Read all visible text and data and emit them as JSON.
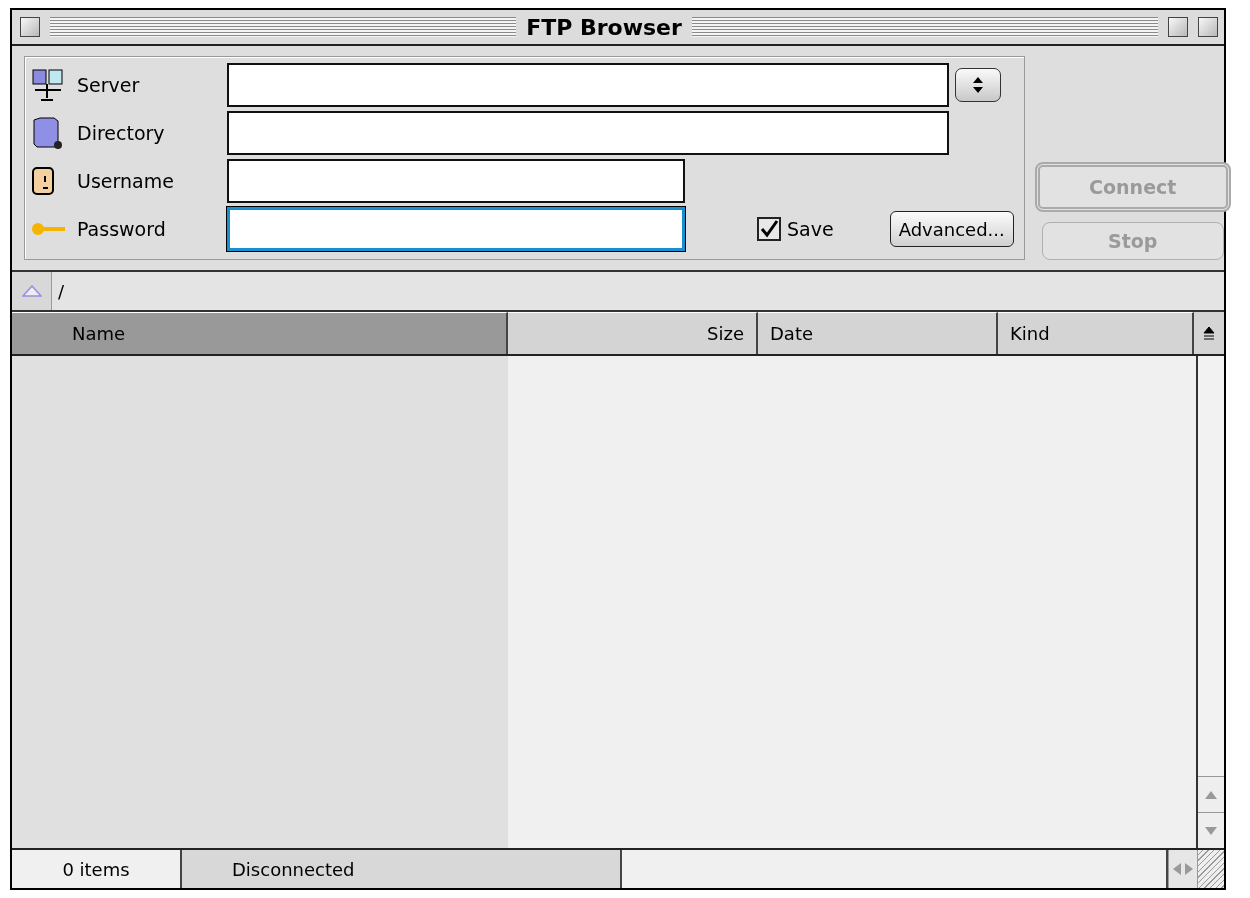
{
  "window": {
    "title": "FTP Browser"
  },
  "form": {
    "fields": [
      {
        "kind": "server",
        "label": "Server",
        "focused": false,
        "dropdown": true
      },
      {
        "kind": "directory",
        "label": "Directory",
        "focused": false,
        "dropdown": false
      },
      {
        "kind": "user",
        "label": "Username",
        "focused": false,
        "dropdown": false
      },
      {
        "kind": "key",
        "label": "Password",
        "focused": true,
        "dropdown": false
      }
    ],
    "save": {
      "label": "Save",
      "checked": true
    },
    "advanced_button": {
      "label": "Advanced...",
      "disabled": false
    },
    "buttons": [
      {
        "label": "Connect",
        "disabled": true,
        "default": true
      },
      {
        "label": "Stop",
        "disabled": true,
        "default": false
      }
    ]
  },
  "path": {
    "text": "/"
  },
  "table": {
    "columns": [
      {
        "label": "Name",
        "selected": true
      },
      {
        "label": "Size",
        "selected": false
      },
      {
        "label": "Date",
        "selected": false
      },
      {
        "label": "Kind",
        "selected": false
      }
    ]
  },
  "status_bar": {
    "count": "0 items",
    "status": "Disconnected"
  }
}
